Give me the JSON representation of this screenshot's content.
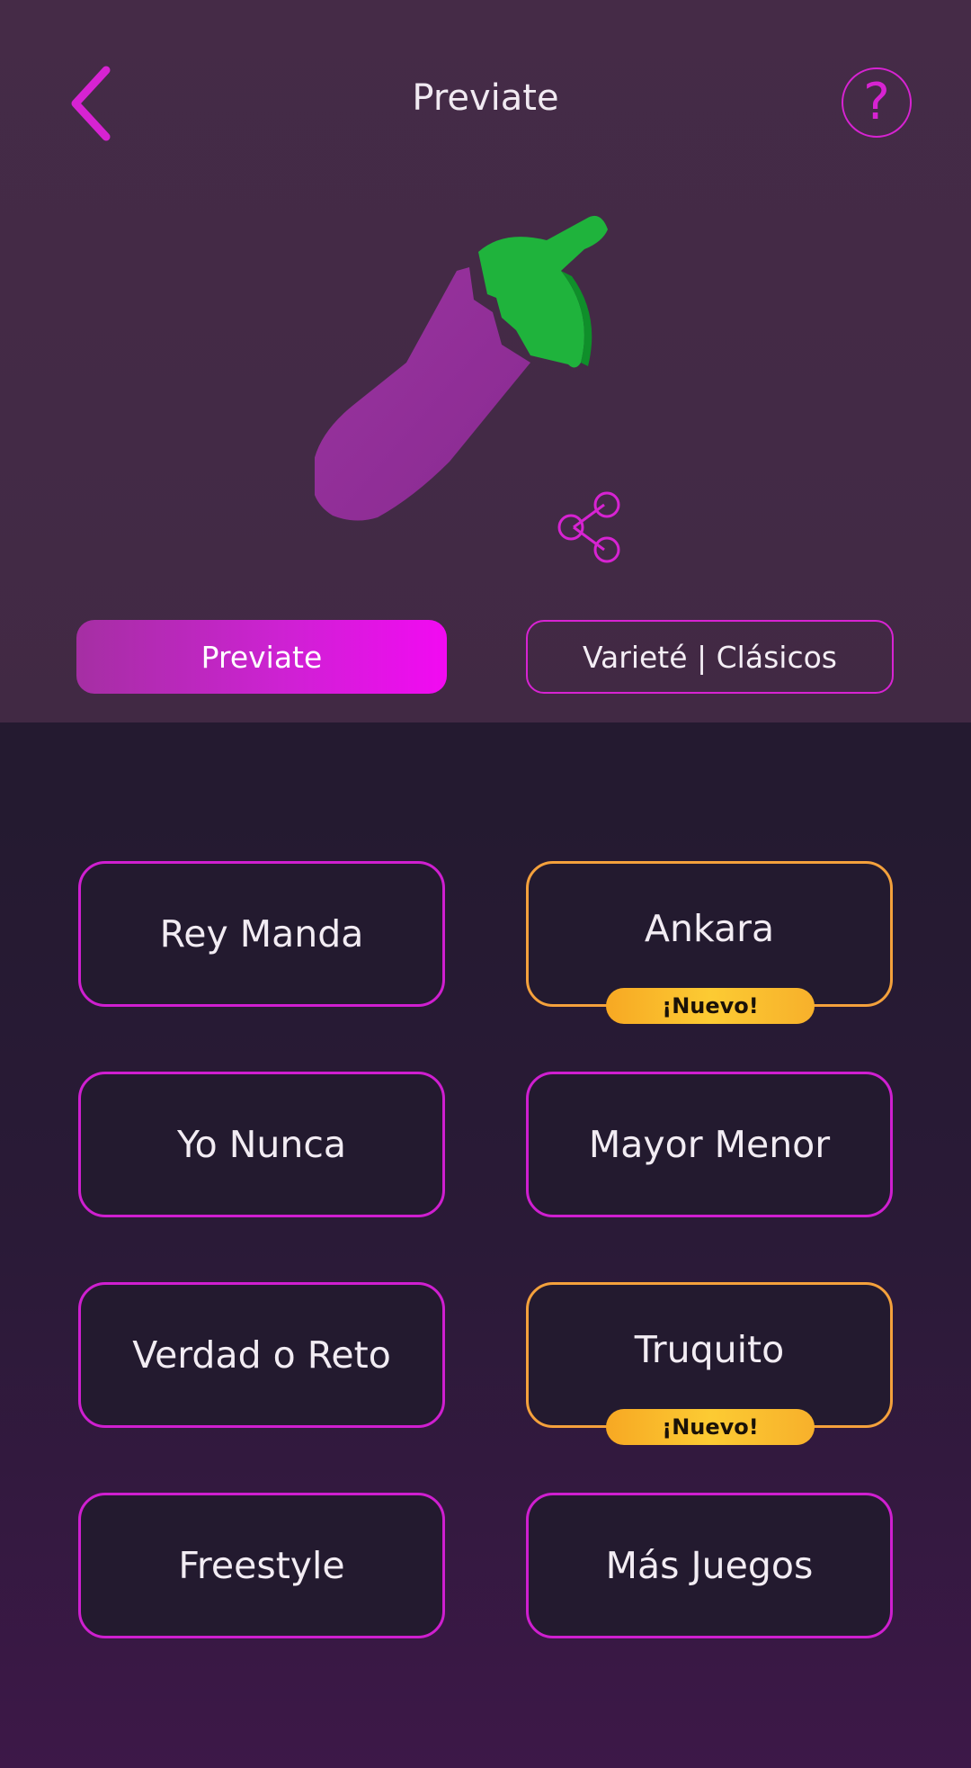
{
  "header": {
    "title": "Previate"
  },
  "help": {
    "glyph": "?"
  },
  "icons": {
    "back": "chevron-left-icon",
    "help": "question-mark-icon",
    "share": "share-icon",
    "hero": "eggplant-icon"
  },
  "colors": {
    "accent": "#d723d2",
    "new_badge": "#fcc233",
    "new_border": "#f4a13c",
    "background": "#241a30"
  },
  "tabs": [
    {
      "label": "Previate",
      "active": true
    },
    {
      "label": "Varieté | Clásicos",
      "active": false
    }
  ],
  "games": [
    {
      "label": "Rey Manda"
    },
    {
      "label": "Ankara",
      "badge": "¡Nuevo!"
    },
    {
      "label": "Yo Nunca"
    },
    {
      "label": "Mayor Menor"
    },
    {
      "label": "Verdad o Reto"
    },
    {
      "label": "Truquito",
      "badge": "¡Nuevo!"
    },
    {
      "label": "Freestyle"
    },
    {
      "label": "Más Juegos"
    }
  ]
}
